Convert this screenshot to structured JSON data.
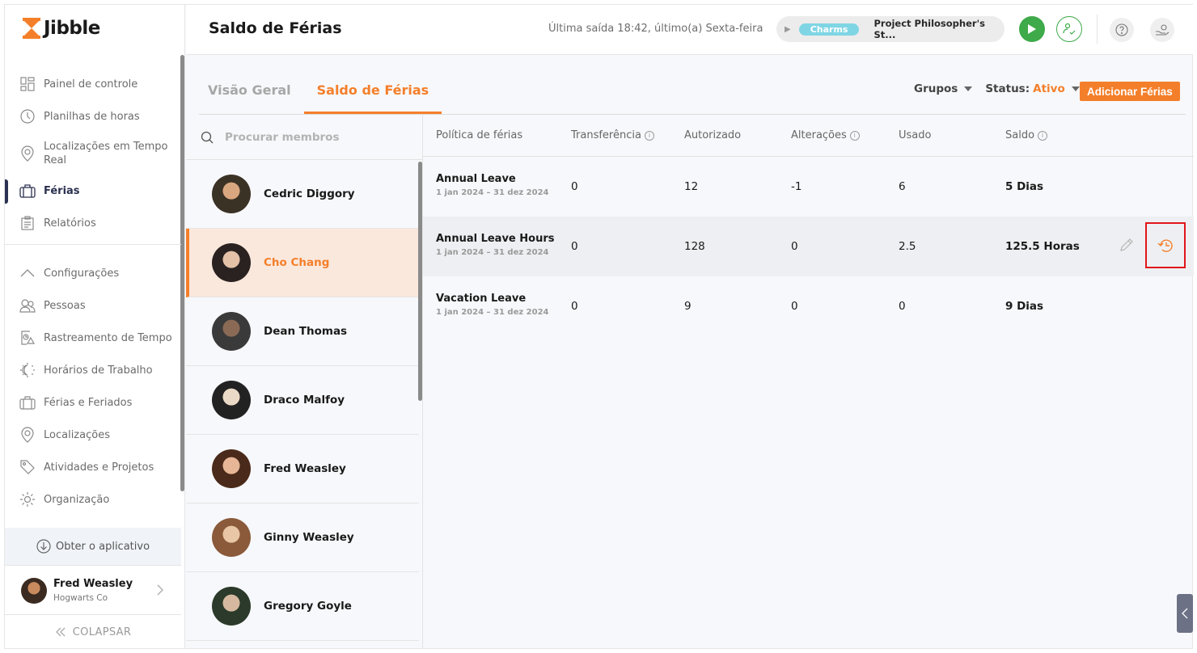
{
  "app": {
    "brand": "Jibble",
    "accent_color": "#f47f2a"
  },
  "sidebar": {
    "primary_items": [
      {
        "label": "Painel de controle",
        "icon": "dashboard-icon"
      },
      {
        "label": "Planilhas de horas",
        "icon": "clock-icon"
      },
      {
        "label": "Localizações em Tempo Real",
        "icon": "location-pin-icon"
      },
      {
        "label": "Férias",
        "icon": "briefcase-icon",
        "active": true
      },
      {
        "label": "Relatórios",
        "icon": "clipboard-icon"
      }
    ],
    "settings_items": [
      {
        "label": "Configurações",
        "icon": "chevron-up-icon"
      },
      {
        "label": "Pessoas",
        "icon": "people-icon"
      },
      {
        "label": "Rastreamento de Tempo",
        "icon": "time-tracking-icon"
      },
      {
        "label": "Horários de Trabalho",
        "icon": "work-schedule-icon"
      },
      {
        "label": "Férias e Feriados",
        "icon": "briefcase-icon"
      },
      {
        "label": "Localizações",
        "icon": "location-pin-icon"
      },
      {
        "label": "Atividades e Projetos",
        "icon": "tag-icon"
      },
      {
        "label": "Organização",
        "icon": "gear-icon"
      }
    ],
    "get_app": "Obter o aplicativo",
    "user": {
      "name": "Fred Weasley",
      "org": "Hogwarts Co"
    },
    "collapse": "COLAPSAR"
  },
  "header": {
    "title": "Saldo de Férias",
    "last_out": "Última saída 18:42, último(a) Sexta-feira",
    "tracker": {
      "activity": "Charms",
      "project": "Project Philosopher's St..."
    }
  },
  "tabs": [
    {
      "label": "Visão Geral",
      "active": false
    },
    {
      "label": "Saldo de Férias",
      "active": true
    }
  ],
  "filters": {
    "groups": "Grupos",
    "status_label": "Status",
    "status_value": "Ativo",
    "add_button": "Adicionar Férias"
  },
  "members": {
    "search_placeholder": "Procurar membros",
    "list": [
      {
        "name": "Cedric Diggory",
        "active": false
      },
      {
        "name": "Cho Chang",
        "active": true
      },
      {
        "name": "Dean Thomas",
        "active": false
      },
      {
        "name": "Draco Malfoy",
        "active": false
      },
      {
        "name": "Fred Weasley",
        "active": false
      },
      {
        "name": "Ginny Weasley",
        "active": false
      },
      {
        "name": "Gregory Goyle",
        "active": false
      }
    ]
  },
  "table": {
    "columns": [
      "Política de férias",
      "Transferência",
      "Autorizado",
      "Alterações",
      "Usado",
      "Saldo"
    ],
    "rows": [
      {
        "policy": "Annual Leave",
        "period": "1 jan 2024 – 31 dez 2024",
        "transfer": "0",
        "authorized": "12",
        "changes": "-1",
        "used": "6",
        "balance": "5 Dias"
      },
      {
        "policy": "Annual Leave Hours",
        "period": "1 jan 2024 – 31 dez 2024",
        "transfer": "0",
        "authorized": "128",
        "changes": "0",
        "used": "2.5",
        "balance": "125.5 Horas"
      },
      {
        "policy": "Vacation Leave",
        "period": "1 jan 2024 – 31 dez 2024",
        "transfer": "0",
        "authorized": "9",
        "changes": "0",
        "used": "0",
        "balance": "9 Dias"
      }
    ]
  }
}
